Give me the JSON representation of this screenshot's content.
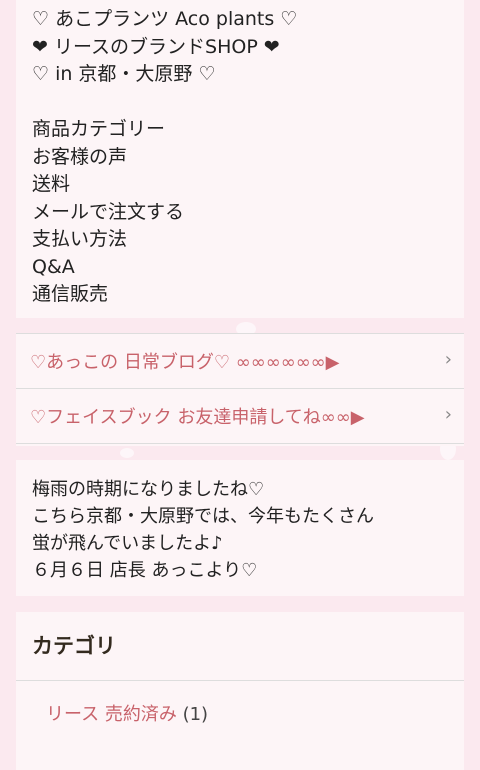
{
  "intro": {
    "lines": [
      "♡ あこプランツ Aco plants ♡",
      "❤ リースのブランドSHOP ❤",
      "♡ in 京都・大原野 ♡"
    ],
    "nav": [
      "商品カテゴリー",
      "お客様の声",
      "送料",
      "メールで注文する",
      "支払い方法",
      "Q&A",
      "通信販売"
    ]
  },
  "links": [
    {
      "label": "♡あっこの 日常ブログ♡ ∞∞∞∞∞∞▶",
      "chevron": "›"
    },
    {
      "label": "♡フェイスブック お友達申請してね∞∞▶",
      "chevron": "›"
    }
  ],
  "notice": {
    "lines": [
      "梅雨の時期になりましたね♡",
      "こちら京都・大原野では、今年もたくさん",
      "蛍が飛んでいましたよ♪",
      "６月６日 店長 あっこより♡"
    ]
  },
  "category": {
    "title": "カテゴリ",
    "item_name": "リース 売約済み",
    "item_count": "(1)"
  }
}
